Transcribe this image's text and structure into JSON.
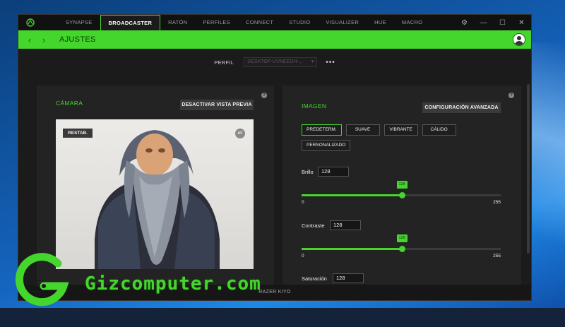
{
  "titlebar": {
    "tabs": [
      {
        "label": "SYNAPSE",
        "active": false
      },
      {
        "label": "BROADCASTER",
        "active": true
      },
      {
        "label": "RATÓN",
        "active": false
      },
      {
        "label": "PERFILES",
        "active": false
      },
      {
        "label": "CONNECT",
        "active": false
      },
      {
        "label": "STUDIO",
        "active": false
      },
      {
        "label": "VISUALIZER",
        "active": false
      },
      {
        "label": "HUE",
        "active": false
      },
      {
        "label": "MACRO",
        "active": false
      }
    ],
    "controls": {
      "settings": "⚙",
      "minimize": "—",
      "maximize": "☐",
      "close": "✕"
    }
  },
  "header": {
    "back": "‹",
    "forward": "›",
    "title": "AJUSTES"
  },
  "profile": {
    "label": "PERFIL",
    "value": "DESKTOP-UVNEEOH-...",
    "more": "•••"
  },
  "camera": {
    "title": "CÁMARA",
    "toggle_preview": "DESACTIVAR VISTA PREVIA",
    "reset": "RESTAB.",
    "af": "AF"
  },
  "image": {
    "title": "IMAGEN",
    "advanced": "CONFIGURACIÓN AVANZADA",
    "presets": [
      {
        "label": "PREDETERM.",
        "active": true
      },
      {
        "label": "SUAVE",
        "active": false
      },
      {
        "label": "VIBRANTE",
        "active": false
      },
      {
        "label": "CÁLIDO",
        "active": false
      },
      {
        "label": "PERSONALIZADO",
        "active": false
      }
    ],
    "controls": [
      {
        "label": "Brillo",
        "value": "128",
        "min": "0",
        "max": "255"
      },
      {
        "label": "Contraste",
        "value": "128",
        "min": "0",
        "max": "255"
      },
      {
        "label": "Saturación",
        "value": "128",
        "min": "0",
        "max": "255"
      }
    ]
  },
  "status": "RAZER KIYO",
  "watermark": "Gizcomputer.com",
  "colors": {
    "accent": "#44d62c",
    "background": "#1b1b1b",
    "panel": "#232323"
  }
}
